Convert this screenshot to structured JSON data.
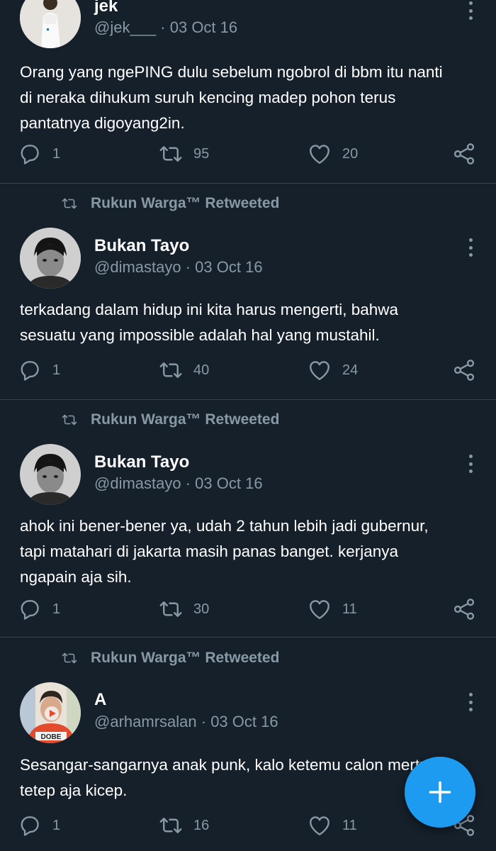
{
  "tweets": [
    {
      "name": "jek",
      "handle": "@jek___",
      "date": "03 Oct 16",
      "text": "Orang yang ngePING dulu sebelum ngobrol di bbm itu nanti\ndi neraka dihukum suruh kencing madep pohon terus\npantatnya digoyang2in.",
      "replies": "1",
      "retweets": "95",
      "likes": "20"
    },
    {
      "retweeted_by": "Rukun Warga™ Retweeted",
      "name": "Bukan Tayo",
      "handle": "@dimastayo",
      "date": "03 Oct 16",
      "text": "terkadang dalam hidup ini kita harus mengerti, bahwa\nsesuatu yang impossible adalah hal yang mustahil.",
      "replies": "1",
      "retweets": "40",
      "likes": "24"
    },
    {
      "retweeted_by": "Rukun Warga™ Retweeted",
      "name": "Bukan Tayo",
      "handle": "@dimastayo",
      "date": "03 Oct 16",
      "text": "ahok ini bener-bener ya, udah 2 tahun lebih jadi gubernur,\ntapi matahari di jakarta masih panas banget. kerjanya\nngapain aja sih.",
      "replies": "1",
      "retweets": "30",
      "likes": "11"
    },
    {
      "retweeted_by": "Rukun Warga™ Retweeted",
      "name": "A",
      "handle": "@arhamrsalan",
      "date": "03 Oct 16",
      "text": "Sesangar-sangarnya anak punk, kalo ketemu calon mertua\ntetep aja kicep.",
      "replies": "1",
      "retweets": "16",
      "likes": "11",
      "avatar_shirt_text": "DOBE"
    }
  ],
  "separator": " · ",
  "colors": {
    "background": "#15202b",
    "secondary_text": "#8899a6",
    "divider": "#38444d",
    "accent": "#1d9bf0"
  },
  "icons": {
    "reply": "reply-icon",
    "retweet": "retweet-icon",
    "like": "heart-icon",
    "share": "share-icon",
    "more": "more-vertical-icon",
    "compose": "plus-icon"
  }
}
